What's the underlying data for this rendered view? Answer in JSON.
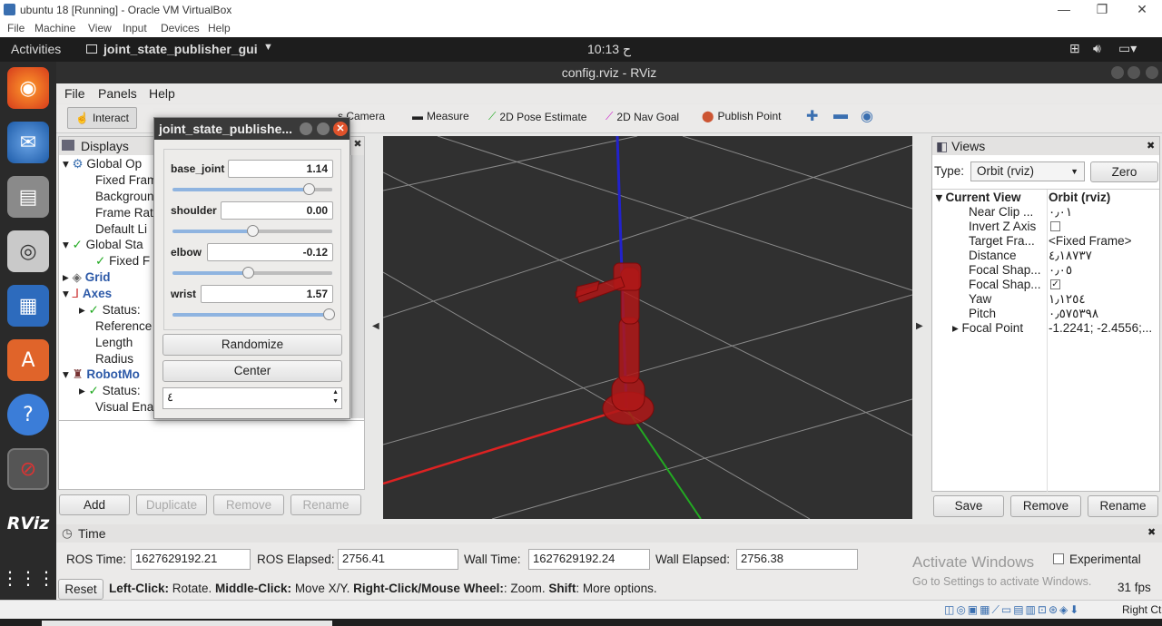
{
  "vbox": {
    "title": "ubuntu 18 [Running] - Oracle VM VirtualBox",
    "menu": [
      "File",
      "Machine",
      "View",
      "Input",
      "Devices",
      "Help"
    ],
    "status_right": "Right Ctrl"
  },
  "ubuntu": {
    "activities": "Activities",
    "app_name": "joint_state_publisher_gui",
    "clock": "10:13 ﺡ"
  },
  "rviz": {
    "title": "config.rviz - RViz",
    "menu": [
      "File",
      "Panels",
      "Help"
    ],
    "toolbar": {
      "interact": "Interact",
      "camera": "s Camera",
      "measure": "Measure",
      "pose_estimate": "2D Pose Estimate",
      "nav_goal": "2D Nav Goal",
      "publish_point": "Publish Point"
    },
    "displays": {
      "header": "Displays",
      "rows": [
        {
          "text": "Global Op"
        },
        {
          "text": "Fixed Fram"
        },
        {
          "text": "Backgroun"
        },
        {
          "text": "Frame Rat"
        },
        {
          "text": "Default Li"
        },
        {
          "text": "Global Sta"
        },
        {
          "text": "Fixed F"
        },
        {
          "text": "Grid"
        },
        {
          "text": "Axes"
        },
        {
          "text": "Status:"
        },
        {
          "text": "Reference"
        },
        {
          "text": "Length"
        },
        {
          "text": "Radius"
        },
        {
          "text": "RobotMo"
        },
        {
          "text": "Status:"
        },
        {
          "text": "Visual Ena"
        }
      ],
      "buttons": {
        "add": "Add",
        "duplicate": "Duplicate",
        "remove": "Remove",
        "rename": "Rename"
      }
    },
    "views": {
      "header": "Views",
      "type_label": "Type:",
      "type_value": "Orbit (rviz)",
      "zero": "Zero",
      "rows": [
        {
          "k": "Current View",
          "v": "Orbit (rviz)"
        },
        {
          "k": "Near Clip ...",
          "v": "۰٫۰۱"
        },
        {
          "k": "Invert Z Axis",
          "v": ""
        },
        {
          "k": "Target Fra...",
          "v": "<Fixed Frame>"
        },
        {
          "k": "Distance",
          "v": "٤٫١٨٧٣٧"
        },
        {
          "k": "Focal Shap...",
          "v": "۰٫۰٥"
        },
        {
          "k": "Focal Shap...",
          "v": "✓"
        },
        {
          "k": "Yaw",
          "v": "١٫١٢٥٤"
        },
        {
          "k": "Pitch",
          "v": "۰٫٥٧٥٣٩٨"
        },
        {
          "k": "Focal Point",
          "v": "-1.2241; -2.4556;..."
        }
      ],
      "buttons": {
        "save": "Save",
        "remove": "Remove",
        "rename": "Rename"
      }
    },
    "time": {
      "header": "Time",
      "ros_time_label": "ROS Time:",
      "ros_time": "1627629192.21",
      "ros_elapsed_label": "ROS Elapsed:",
      "ros_elapsed": "2756.41",
      "wall_time_label": "Wall Time:",
      "wall_time": "1627629192.24",
      "wall_elapsed_label": "Wall Elapsed:",
      "wall_elapsed": "2756.38",
      "experimental": "Experimental",
      "reset": "Reset",
      "help_parts": [
        {
          "b": "Left-Click:",
          "t": " Rotate. "
        },
        {
          "b": "Middle-Click:",
          "t": " Move X/Y. "
        },
        {
          "b": "Right-Click/Mouse Wheel:",
          "t": ": Zoom. "
        },
        {
          "b": "Shift",
          "t": ": More options."
        }
      ],
      "fps": "31 fps",
      "activate_1": "Activate Windows",
      "activate_2": "Go to Settings to activate Windows."
    }
  },
  "joint_dialog": {
    "title": "joint_state_publishe...",
    "joints": [
      {
        "name": "base_joint",
        "value": "1.14",
        "fraction": 0.85
      },
      {
        "name": "shoulder",
        "value": "0.00",
        "fraction": 0.5
      },
      {
        "name": "elbow",
        "value": "-0.12",
        "fraction": 0.47
      },
      {
        "name": "wrist",
        "value": "1.57",
        "fraction": 0.98
      }
    ],
    "randomize": "Randomize",
    "center": "Center",
    "spin_value": "٤"
  },
  "colors": {
    "accent_blue": "#2d5aa8",
    "robot_red": "#b01818"
  }
}
